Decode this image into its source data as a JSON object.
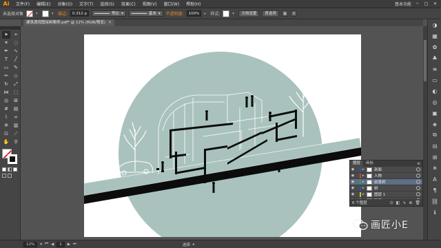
{
  "app": {
    "logo": "Ai",
    "menus": [
      "文件(F)",
      "编辑(E)",
      "对象(O)",
      "文字(T)",
      "选择(S)",
      "效果(C)",
      "视图(V)",
      "窗口(W)",
      "帮助(H)"
    ],
    "workspace": "基本功能"
  },
  "control_bar": {
    "selection": "未选择对象",
    "stroke_label": "描边:",
    "stroke_weight": "0.312 p",
    "profile_label": "等比",
    "brush_label": "基本",
    "opacity_label": "不透明度:",
    "opacity_value": "100%",
    "style_label": "样式:",
    "doc_setup_button": "文档设置",
    "prefs_button": "首选项"
  },
  "document": {
    "tab_title": "建筑透视图绘制案例.pdf* @ 12% (RGB/预览)"
  },
  "layers_panel": {
    "tabs": [
      "图层",
      "画板"
    ],
    "layers": [
      {
        "name": "剖面",
        "color": "#2a52d6"
      },
      {
        "name": "人物",
        "color": "#d63c3c"
      },
      {
        "name": "前景树",
        "color": "#2ba64a"
      },
      {
        "name": "树",
        "color": "#2a52d6"
      },
      {
        "name": "图层 1",
        "color": "#d6c42a"
      },
      {
        "name": "轮廓",
        "color": "#2aa6d6"
      }
    ],
    "selected_index": 2,
    "footer": "6 个图层"
  },
  "status_bar": {
    "zoom": "12%",
    "artboard": "1",
    "tool": "选择"
  },
  "watermark": {
    "text": "画匠小E"
  },
  "colors": {
    "circle": "#a9c2bd",
    "artboard": "#ffffff",
    "ground": "#0c0c0c",
    "accent_orange": "#e58a1f"
  }
}
